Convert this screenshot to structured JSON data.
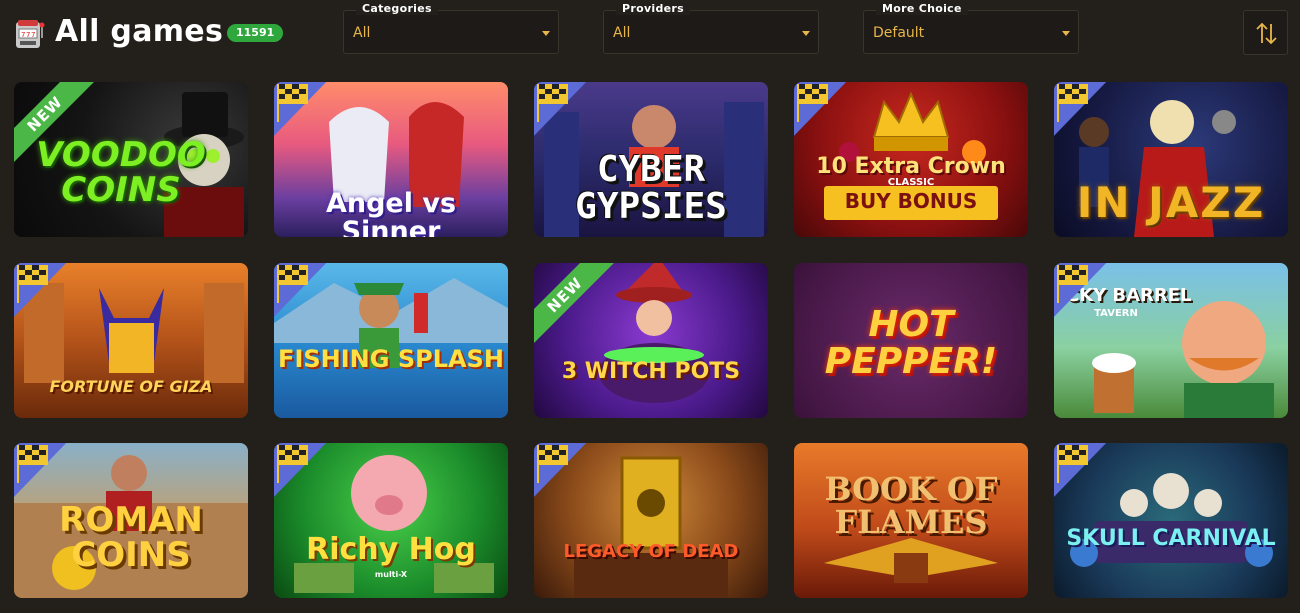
{
  "header": {
    "title": "All games",
    "count": "11591",
    "icon": "slot-machine-icon"
  },
  "filters": [
    {
      "label": "Categories",
      "value": "All"
    },
    {
      "label": "Providers",
      "value": "All"
    },
    {
      "label": "More Choice",
      "value": "Default"
    }
  ],
  "sort": {
    "icon": "sort-arrows-icon"
  },
  "colors": {
    "accent": "#e8b64a",
    "badge": "#2ea83c",
    "background": "#231f1b",
    "new_ribbon": "#4bb746"
  },
  "games": [
    {
      "title": "VOODOO COINS",
      "badge": "NEW",
      "flag": false
    },
    {
      "title": "Angel vs Sinner",
      "badge": "",
      "flag": true
    },
    {
      "title": "CYBER GYPSIES",
      "badge": "",
      "flag": true
    },
    {
      "title": "10 Extra Crown",
      "subtitle": "CLASSIC",
      "extra": "BUY BONUS",
      "badge": "",
      "flag": true
    },
    {
      "title": "IN JAZZ",
      "badge": "",
      "flag": true
    },
    {
      "title": "FORTUNE OF GIZA",
      "badge": "",
      "flag": true
    },
    {
      "title": "FISHING SPLASH",
      "badge": "",
      "flag": true
    },
    {
      "title": "3 WITCH POTS",
      "badge": "NEW",
      "flag": false
    },
    {
      "title": "HOT PEPPER!",
      "badge": "",
      "flag": false
    },
    {
      "title": "LUCKY BARREL",
      "subtitle": "TAVERN",
      "badge": "",
      "flag": true
    },
    {
      "title": "ROMAN COINS",
      "badge": "",
      "flag": true
    },
    {
      "title": "Richy Hog",
      "subtitle": "multi-X",
      "badge": "",
      "flag": true
    },
    {
      "title": "LEGACY OF DEAD",
      "badge": "",
      "flag": true
    },
    {
      "title": "BOOK OF FLAMES",
      "badge": "",
      "flag": false
    },
    {
      "title": "SKULL CARNIVAL",
      "badge": "",
      "flag": true
    }
  ]
}
